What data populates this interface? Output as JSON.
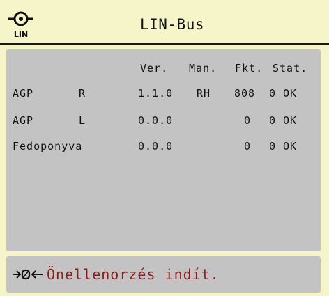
{
  "header": {
    "logo_label": "LIN",
    "title": "LIN-Bus"
  },
  "table": {
    "columns": [
      "Ver.",
      "Man.",
      "Fkt.",
      "Stat."
    ],
    "rows": [
      {
        "name": "AGP",
        "side": "R",
        "ver": "1.1.0",
        "man": "RH",
        "fkt": "808",
        "n": "0",
        "stat": "OK"
      },
      {
        "name": "AGP",
        "side": "L",
        "ver": "0.0.0",
        "man": "",
        "fkt": "0",
        "n": "0",
        "stat": "OK"
      },
      {
        "name": "Fedoponyva",
        "side": "",
        "ver": "0.0.0",
        "man": "",
        "fkt": "0",
        "n": "0",
        "stat": "OK"
      }
    ]
  },
  "footer": {
    "icon_name": "self-test-icon",
    "label": "Önellenorzés indít."
  },
  "colors": {
    "background": "#f5f5c9",
    "panel": "#c3c3c3",
    "footer_text": "#8a1d1d"
  }
}
